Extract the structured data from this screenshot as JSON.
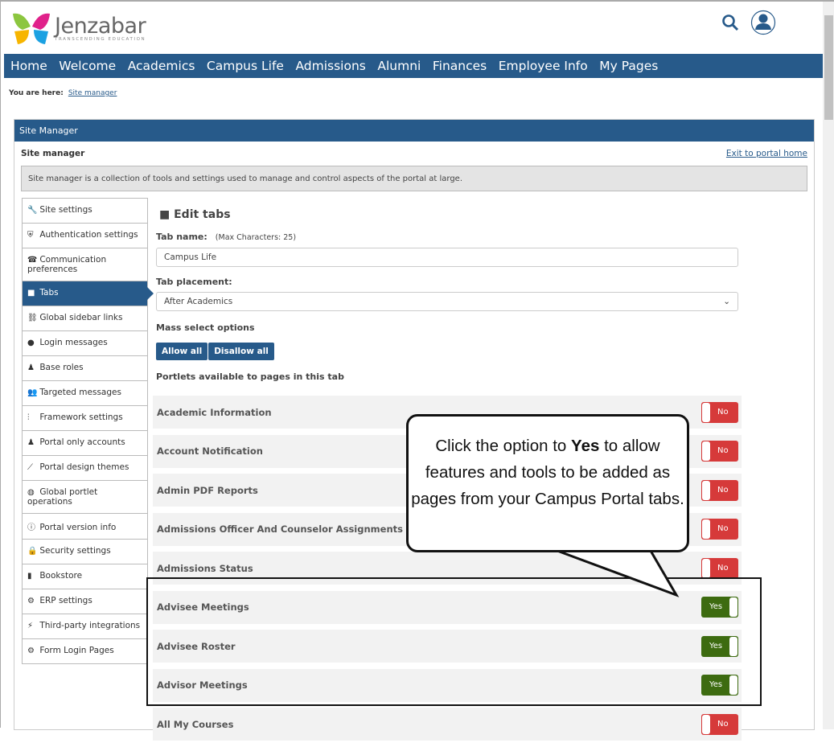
{
  "brand": {
    "name": "Jenzabar",
    "tagline": "TRANSCENDING EDUCATION"
  },
  "nav": [
    "Home",
    "Welcome",
    "Academics",
    "Campus Life",
    "Admissions",
    "Alumni",
    "Finances",
    "Employee Info",
    "My Pages"
  ],
  "breadcrumb": {
    "label": "You are here:",
    "link": "Site manager"
  },
  "panel": {
    "header": "Site Manager",
    "title": "Site manager",
    "exit": "Exit to portal home",
    "description": "Site manager is a collection of tools and settings used to manage and control aspects of the portal at large."
  },
  "sidebar": [
    {
      "icon": "wrench",
      "label": "Site settings"
    },
    {
      "icon": "shield",
      "label": "Authentication settings"
    },
    {
      "icon": "phone",
      "label": "Communication preferences"
    },
    {
      "icon": "folder",
      "label": "Tabs"
    },
    {
      "icon": "link",
      "label": "Global sidebar links"
    },
    {
      "icon": "comment",
      "label": "Login messages"
    },
    {
      "icon": "user",
      "label": "Base roles"
    },
    {
      "icon": "users",
      "label": "Targeted messages"
    },
    {
      "icon": "sliders",
      "label": "Framework settings"
    },
    {
      "icon": "user-plus",
      "label": "Portal only accounts"
    },
    {
      "icon": "brush",
      "label": "Portal design themes"
    },
    {
      "icon": "globe",
      "label": "Global portlet operations"
    },
    {
      "icon": "info",
      "label": "Portal version info"
    },
    {
      "icon": "lock",
      "label": "Security settings"
    },
    {
      "icon": "book",
      "label": "Bookstore"
    },
    {
      "icon": "gear",
      "label": "ERP settings"
    },
    {
      "icon": "plug",
      "label": "Third-party integrations"
    },
    {
      "icon": "gears",
      "label": "Form Login Pages"
    }
  ],
  "main": {
    "heading": "Edit tabs",
    "tab_name_label": "Tab name:",
    "max_chars": "(Max Characters: 25)",
    "tab_name_value": "Campus Life",
    "placement_label": "Tab placement:",
    "placement_value": "After Academics",
    "mass_label": "Mass select options",
    "allow_all": "Allow all",
    "disallow_all": "Disallow all",
    "portlets_label": "Portlets available to pages in this tab"
  },
  "portlets": [
    {
      "name": "Academic Information",
      "value": "No"
    },
    {
      "name": "Account Notification",
      "value": "No"
    },
    {
      "name": "Admin PDF Reports",
      "value": "No"
    },
    {
      "name": "Admissions Officer And Counselor Assignments",
      "value": "No"
    },
    {
      "name": "Admissions Status",
      "value": "No"
    },
    {
      "name": "Advisee Meetings",
      "value": "Yes"
    },
    {
      "name": "Advisee Roster",
      "value": "Yes"
    },
    {
      "name": "Advisor Meetings",
      "value": "Yes"
    },
    {
      "name": "All My Courses",
      "value": "No"
    }
  ],
  "callout": {
    "pre": "Click the option to ",
    "bold": "Yes",
    "post": " to allow features and tools to be added as pages from your Campus Portal tabs."
  }
}
